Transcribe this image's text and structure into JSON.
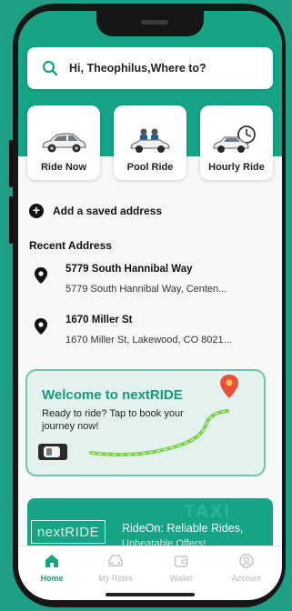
{
  "search": {
    "prompt": "Hi, Theophilus,Where to?",
    "icon": "search-icon"
  },
  "ride_options": [
    {
      "label": "Ride Now",
      "icon": "car-icon"
    },
    {
      "label": "Pool Ride",
      "icon": "pool-car-icon"
    },
    {
      "label": "Hourly Ride",
      "icon": "hourly-car-icon"
    }
  ],
  "saved": {
    "add_label": "Add a saved address"
  },
  "recent": {
    "title": "Recent Address",
    "items": [
      {
        "title": "5779 South Hannibal Way",
        "subtitle": "5779 South Hannibal Way, Centen..."
      },
      {
        "title": "1670 Miller St",
        "subtitle": "1670 Miller St, Lakewood, CO 8021..."
      }
    ]
  },
  "welcome": {
    "title": "Welcome to nextRIDE",
    "subtitle": "Ready to ride? Tap to book your journey now!"
  },
  "promo": {
    "logo": "nextRIDE",
    "badge": "TAXI",
    "headline": "RideOn: Reliable Rides,",
    "subline": "Unbeatable Offers!"
  },
  "tabs": [
    {
      "label": "Home",
      "icon": "home-icon",
      "active": true
    },
    {
      "label": "My Rides",
      "icon": "car-icon",
      "active": false
    },
    {
      "label": "Wallet",
      "icon": "wallet-icon",
      "active": false
    },
    {
      "label": "Account",
      "icon": "account-icon",
      "active": false
    }
  ],
  "colors": {
    "brand_teal": "#16a386",
    "background": "#1f9f86",
    "route_green": "#7cd14a",
    "pin_red": "#e8503a"
  }
}
